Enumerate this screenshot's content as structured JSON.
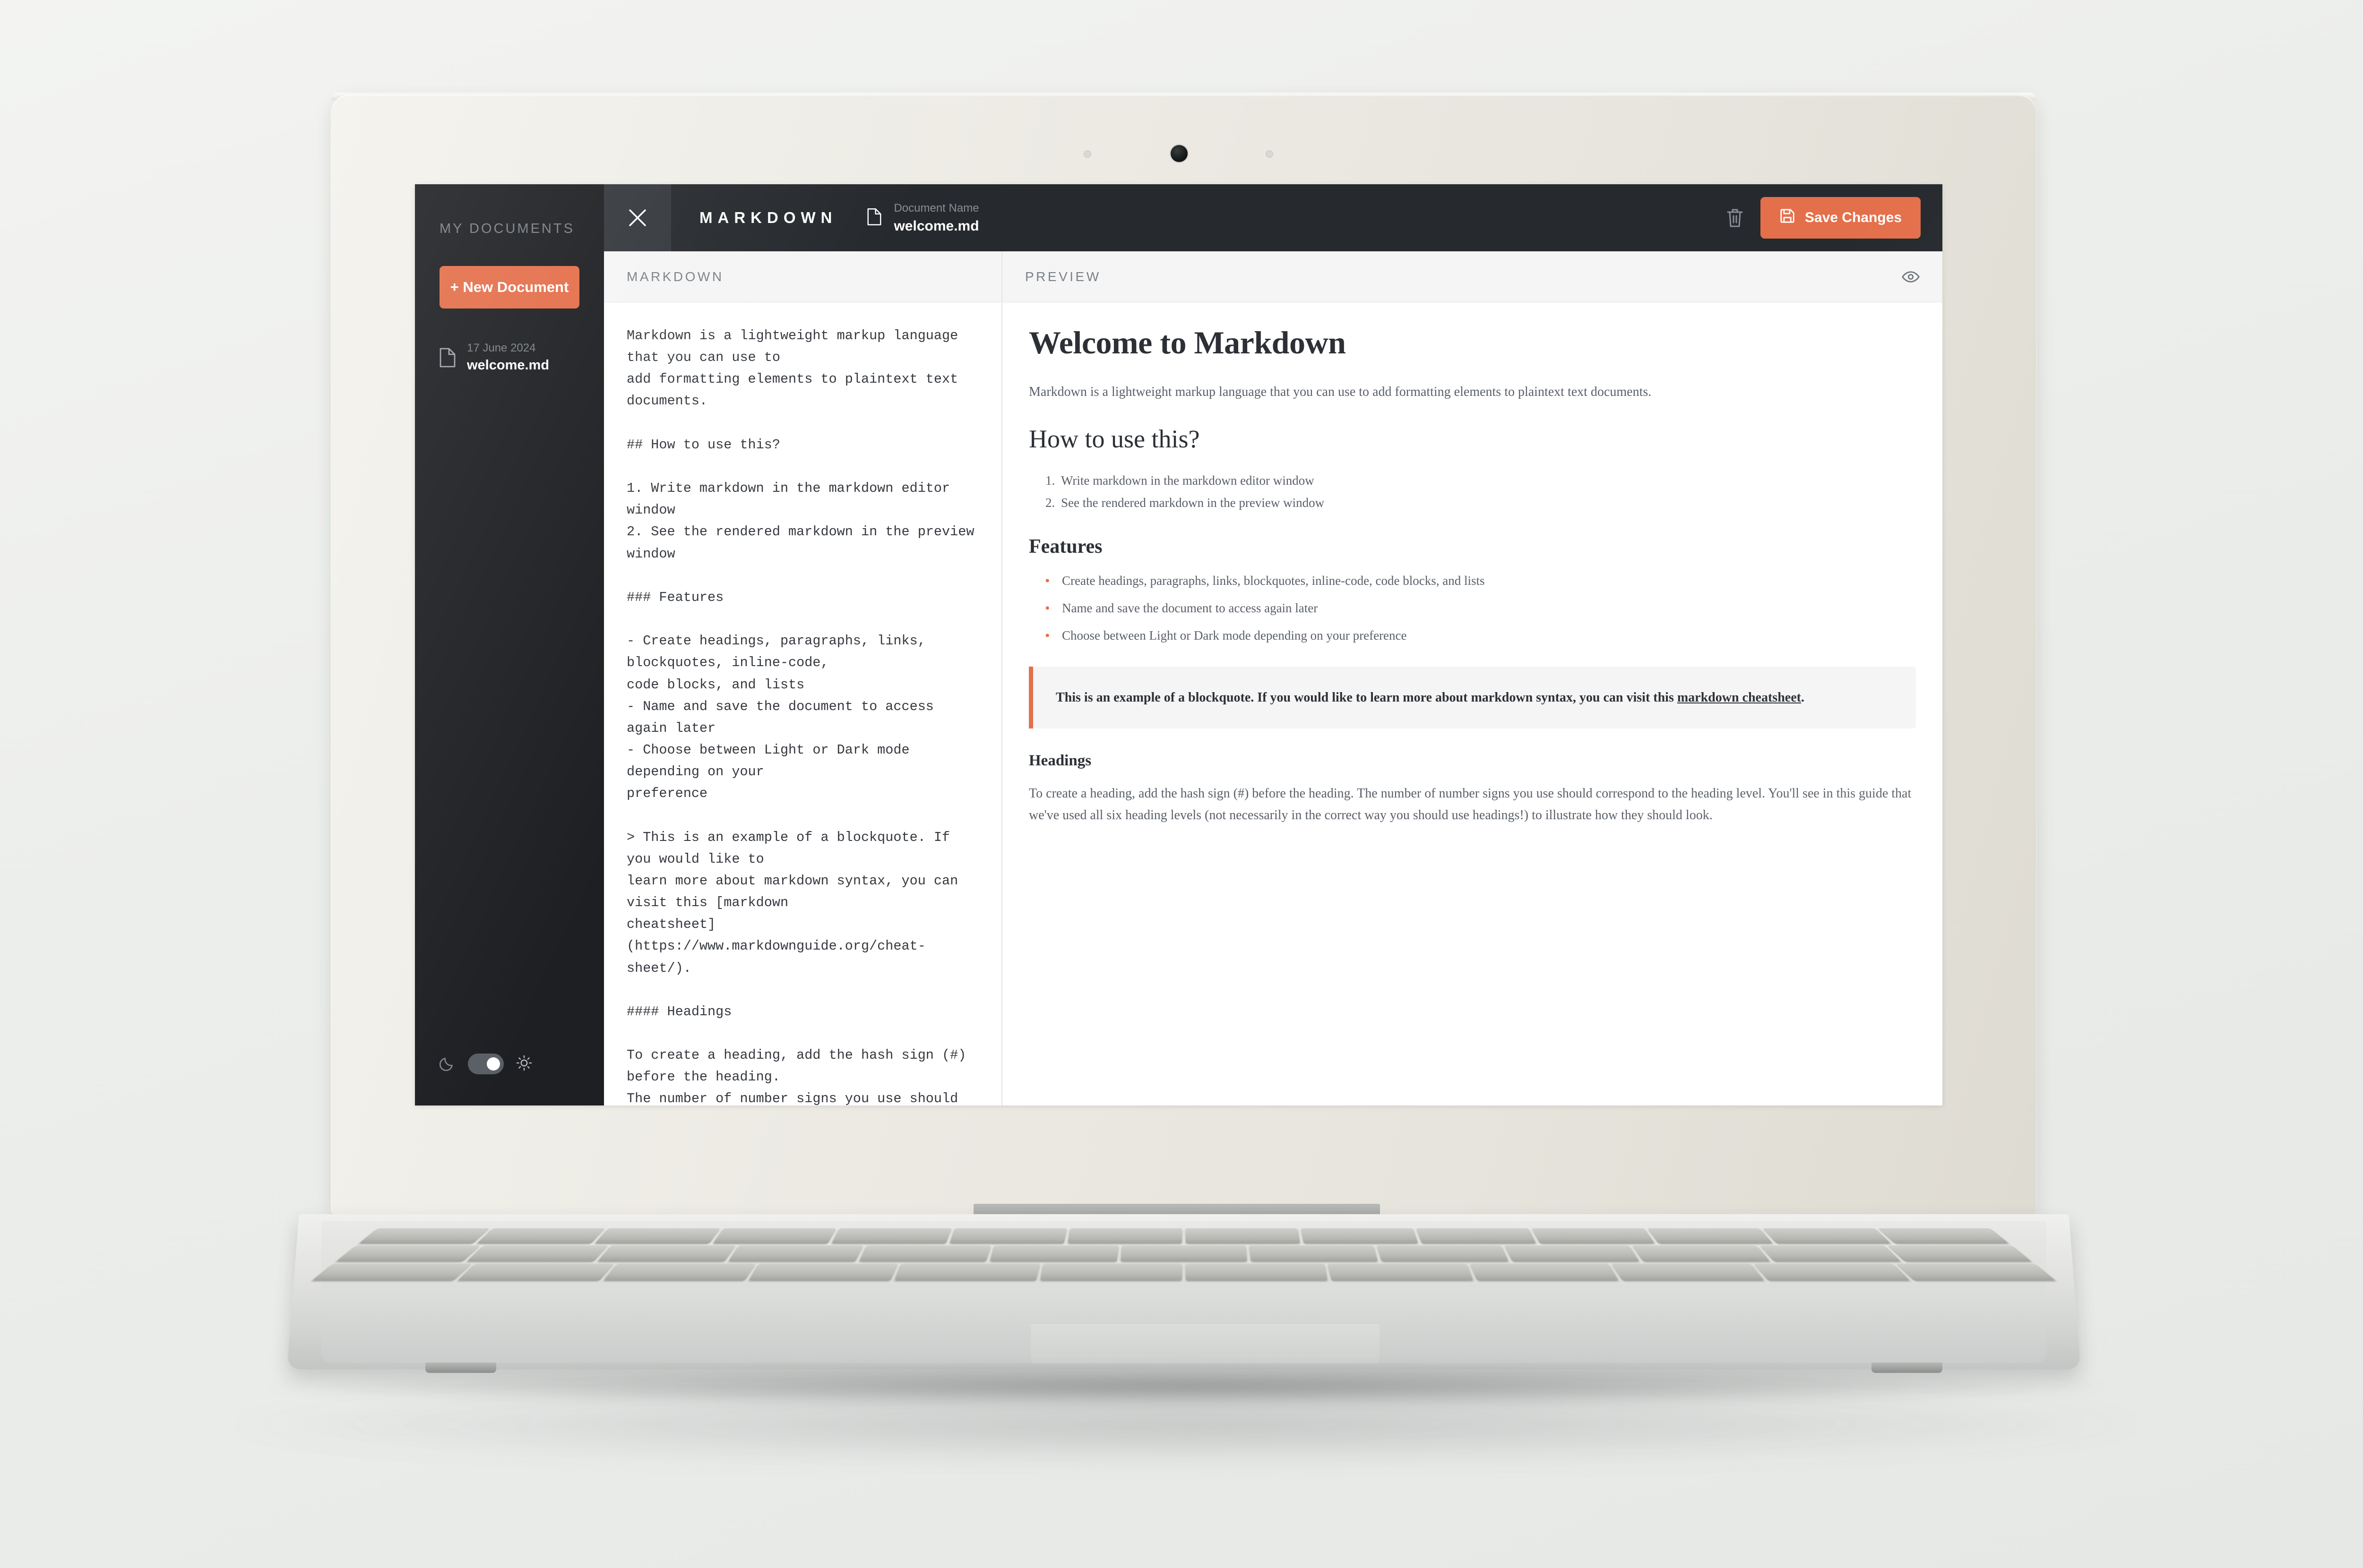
{
  "sidebar": {
    "title": "MY DOCUMENTS",
    "new_document_label": "+ New Document",
    "documents": [
      {
        "date": "17 June 2024",
        "name": "welcome.md",
        "icon": "document-icon"
      }
    ],
    "theme": {
      "dark_icon": "moon-icon",
      "light_icon": "sun-icon",
      "state": "light"
    }
  },
  "topbar": {
    "close_icon": "close-icon",
    "app_name": "MARKDOWN",
    "document_icon": "document-icon",
    "document_name_label": "Document Name",
    "document_name_value": "welcome.md",
    "delete_icon": "trash-icon",
    "save_icon": "save-icon",
    "save_label": "Save Changes"
  },
  "editor": {
    "header_title": "MARKDOWN",
    "content": "Markdown is a lightweight markup language that you can use to\nadd formatting elements to plaintext text documents.\n\n## How to use this?\n\n1. Write markdown in the markdown editor window\n2. See the rendered markdown in the preview window\n\n### Features\n\n- Create headings, paragraphs, links, blockquotes, inline-code,\ncode blocks, and lists\n- Name and save the document to access again later\n- Choose between Light or Dark mode depending on your\npreference\n\n> This is an example of a blockquote. If you would like to\nlearn more about markdown syntax, you can visit this [markdown\ncheatsheet](https://www.markdownguide.org/cheat-sheet/).\n\n#### Headings\n\nTo create a heading, add the hash sign (#) before the heading.\nThe number of number signs you use should correspond to the\nheading level. You'll see in this guide that we've used all six\nheading levels (not necessarily in the correct way you should\nuse headings!) to illustrate how they should look."
  },
  "preview": {
    "header_title": "PREVIEW",
    "eye_icon": "eye-icon",
    "h1": "Welcome to Markdown",
    "intro": "Markdown is a lightweight markup language that you can use to add formatting elements to plaintext text documents.",
    "h2": "How to use this?",
    "ordered_list": [
      "Write markdown in the markdown editor window",
      "See the rendered markdown in the preview window"
    ],
    "h3_features": "Features",
    "features": [
      "Create headings, paragraphs, links, blockquotes, inline-code, code blocks, and lists",
      "Name and save the document to access again later",
      "Choose between Light or Dark mode depending on your preference"
    ],
    "blockquote_before": "This is an example of a blockquote. If you would like to learn more about markdown syntax, you can visit this ",
    "blockquote_link": "markdown cheatsheet",
    "blockquote_after": ".",
    "h4_headings": "Headings",
    "headings_paragraph": "To create a heading, add the hash sign (#) before the heading. The number of number signs you use should correspond to the heading level. You'll see in this guide that we've used all six heading levels (not necessarily in the correct way you should use headings!) to illustrate how they should look."
  },
  "colors": {
    "accent": "#e46f4b",
    "sidebar_bg": "#1d1f22",
    "topbar_bg": "#26292d",
    "close_bg": "#34383d",
    "muted_text": "#7c8187"
  },
  "device": {
    "type": "laptop",
    "camera_icon": "camera-icon"
  }
}
